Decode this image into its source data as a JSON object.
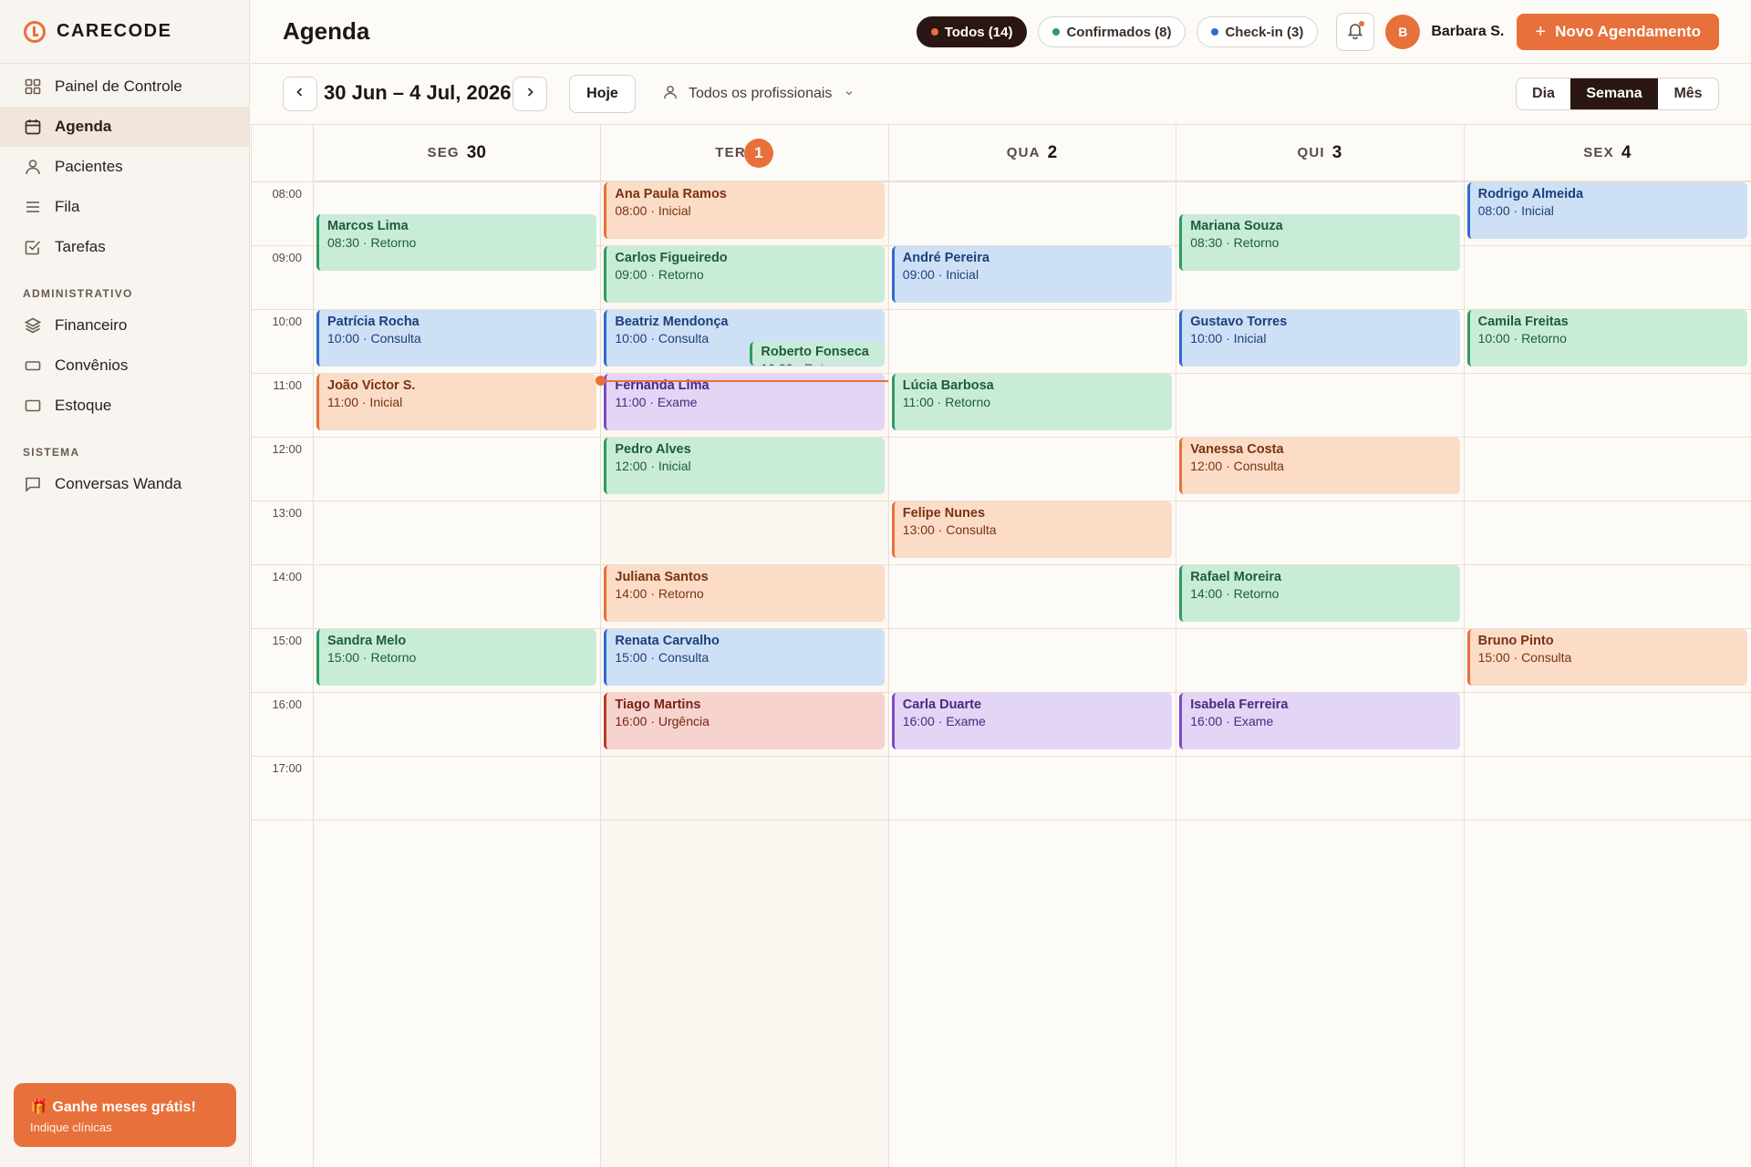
{
  "brand": {
    "name": "CARECODE"
  },
  "sidebar": {
    "items": [
      {
        "label": "Painel de Controle",
        "icon": "grid-icon",
        "active": false
      },
      {
        "label": "Agenda",
        "icon": "calendar-icon",
        "active": true
      },
      {
        "label": "Pacientes",
        "icon": "user-icon",
        "active": false
      },
      {
        "label": "Fila",
        "icon": "list-icon",
        "active": false
      },
      {
        "label": "Tarefas",
        "icon": "checkbox-icon",
        "active": false
      }
    ],
    "admin_section": "ADMINISTRATIVO",
    "admin_items": [
      {
        "label": "Financeiro",
        "icon": "layers-icon"
      },
      {
        "label": "Convênios",
        "icon": "card-icon"
      },
      {
        "label": "Estoque",
        "icon": "box-icon"
      }
    ],
    "system_section": "SISTEMA",
    "system_items": [
      {
        "label": "Conversas Wanda",
        "icon": "chat-icon"
      }
    ],
    "promo": {
      "title": "🎁 Ganhe meses grátis!",
      "subtitle": "Indique clínicas"
    }
  },
  "header": {
    "title": "Agenda",
    "filters": [
      {
        "label": "Todos (14)",
        "dot": "#e8703a",
        "active": true
      },
      {
        "label": "Confirmados (8)",
        "dot": "#2f9a63",
        "active": false
      },
      {
        "label": "Check-in (3)",
        "dot": "#2f6bd0",
        "active": false
      }
    ],
    "user": {
      "initial": "B",
      "name": "Barbara S."
    },
    "new_button": "Novo Agendamento"
  },
  "toolbar": {
    "range": "30 Jun – 4 Jul, 2026",
    "today": "Hoje",
    "professional": "Todos os profissionais",
    "views": [
      "Dia",
      "Semana",
      "Mês"
    ],
    "selected_view": "Semana"
  },
  "calendar": {
    "days": [
      {
        "weekday": "SEG",
        "num": "30",
        "today": false
      },
      {
        "weekday": "TER",
        "num": "1",
        "today": true
      },
      {
        "weekday": "QUA",
        "num": "2",
        "today": false
      },
      {
        "weekday": "QUI",
        "num": "3",
        "today": false
      },
      {
        "weekday": "SEX",
        "num": "4",
        "today": false
      }
    ],
    "hours": [
      "08:00",
      "09:00",
      "10:00",
      "11:00",
      "12:00",
      "13:00",
      "14:00",
      "15:00",
      "16:00",
      "17:00"
    ],
    "now_time": "11:07",
    "types": {
      "Retorno": {
        "bg": "#c9ecd9",
        "border": "#2f9a63",
        "text": "#1e5c3c"
      },
      "Inicial": {
        "bg": "#cde0f5",
        "border": "#2f6bd0",
        "text": "#1e3f7a"
      },
      "Consulta": {
        "bg": "#cde0f5",
        "border": "#2f6bd0",
        "text": "#1e3f7a"
      },
      "Exame": {
        "bg": "#e2d5f5",
        "border": "#7b4bc8",
        "text": "#4a2a7d"
      },
      "Urgência": {
        "bg": "#f6d3cd",
        "border": "#c0392b",
        "text": "#7a2418"
      },
      "Peach": {
        "bg": "#fbdcc6",
        "border": "#e8703a",
        "text": "#7a3214"
      }
    },
    "appointments": [
      {
        "day": 0,
        "start": "08:30",
        "name": "Marcos Lima",
        "type": "Retorno",
        "style": "Retorno"
      },
      {
        "day": 0,
        "start": "10:00",
        "name": "Patrícia Rocha",
        "type": "Consulta",
        "style": "Consulta"
      },
      {
        "day": 0,
        "start": "11:00",
        "name": "João Victor S.",
        "type": "Inicial",
        "style": "Peach"
      },
      {
        "day": 0,
        "start": "15:00",
        "name": "Sandra Melo",
        "type": "Retorno",
        "style": "Retorno"
      },
      {
        "day": 1,
        "start": "08:00",
        "name": "Ana Paula Ramos",
        "type": "Inicial",
        "style": "Peach"
      },
      {
        "day": 1,
        "start": "09:00",
        "name": "Carlos Figueiredo",
        "type": "Retorno",
        "style": "Retorno"
      },
      {
        "day": 1,
        "start": "10:00",
        "name": "Beatriz Mendonça",
        "type": "Consulta",
        "style": "Consulta"
      },
      {
        "day": 1,
        "start": "10:30",
        "name": "Roberto Fonseca",
        "type": "Retorno",
        "style": "Retorno",
        "overlap": true
      },
      {
        "day": 1,
        "start": "11:00",
        "name": "Fernanda Lima",
        "type": "Exame",
        "style": "Exame"
      },
      {
        "day": 1,
        "start": "12:00",
        "name": "Pedro Alves",
        "type": "Inicial",
        "style": "Retorno"
      },
      {
        "day": 1,
        "start": "14:00",
        "name": "Juliana Santos",
        "type": "Retorno",
        "style": "Peach"
      },
      {
        "day": 1,
        "start": "15:00",
        "name": "Renata Carvalho",
        "type": "Consulta",
        "style": "Consulta"
      },
      {
        "day": 1,
        "start": "16:00",
        "name": "Tiago Martins",
        "type": "Urgência",
        "style": "Urgência"
      },
      {
        "day": 2,
        "start": "09:00",
        "name": "André Pereira",
        "type": "Inicial",
        "style": "Inicial"
      },
      {
        "day": 2,
        "start": "11:00",
        "name": "Lúcia Barbosa",
        "type": "Retorno",
        "style": "Retorno"
      },
      {
        "day": 2,
        "start": "13:00",
        "name": "Felipe Nunes",
        "type": "Consulta",
        "style": "Peach"
      },
      {
        "day": 2,
        "start": "16:00",
        "name": "Carla Duarte",
        "type": "Exame",
        "style": "Exame"
      },
      {
        "day": 3,
        "start": "08:30",
        "name": "Mariana Souza",
        "type": "Retorno",
        "style": "Retorno"
      },
      {
        "day": 3,
        "start": "10:00",
        "name": "Gustavo Torres",
        "type": "Inicial",
        "style": "Inicial"
      },
      {
        "day": 3,
        "start": "12:00",
        "name": "Vanessa Costa",
        "type": "Consulta",
        "style": "Peach"
      },
      {
        "day": 3,
        "start": "14:00",
        "name": "Rafael Moreira",
        "type": "Retorno",
        "style": "Retorno"
      },
      {
        "day": 3,
        "start": "16:00",
        "name": "Isabela Ferreira",
        "type": "Exame",
        "style": "Exame"
      },
      {
        "day": 4,
        "start": "08:00",
        "name": "Rodrigo Almeida",
        "type": "Inicial",
        "style": "Inicial"
      },
      {
        "day": 4,
        "start": "10:00",
        "name": "Camila Freitas",
        "type": "Retorno",
        "style": "Retorno"
      },
      {
        "day": 4,
        "start": "15:00",
        "name": "Bruno Pinto",
        "type": "Consulta",
        "style": "Peach"
      }
    ]
  }
}
